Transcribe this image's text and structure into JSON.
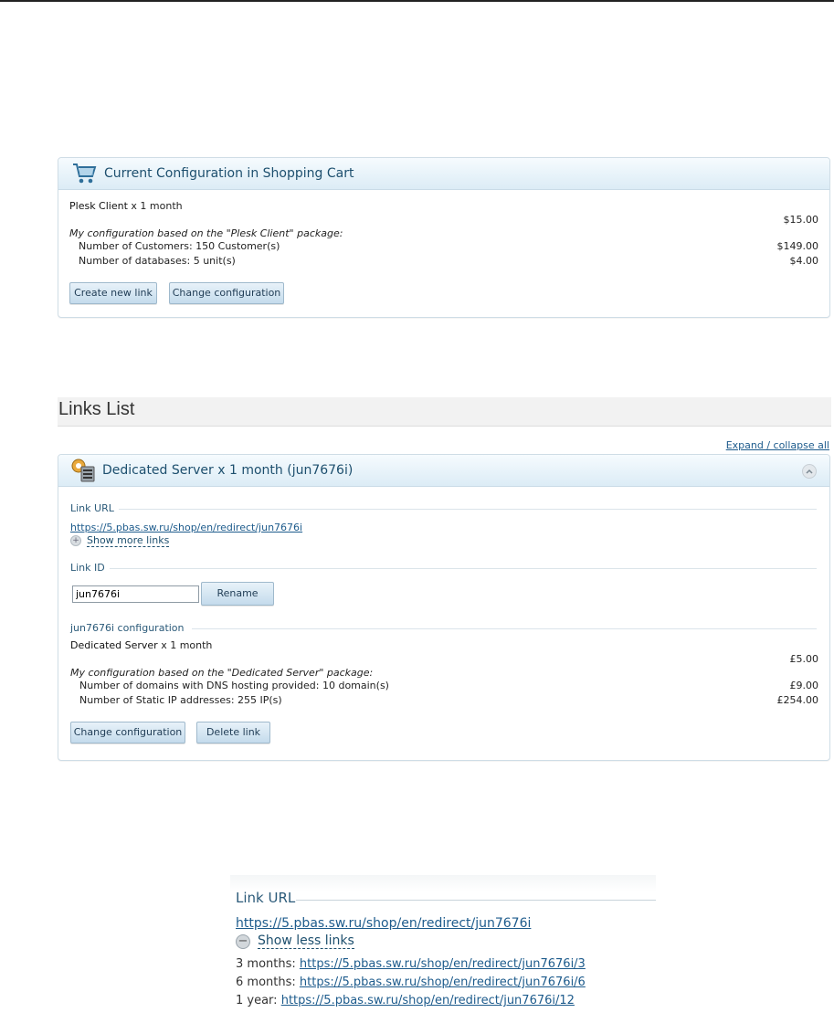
{
  "cart": {
    "title": "Current Configuration in Shopping Cart",
    "product_name": "Plesk Client",
    "product_term": "x 1 month",
    "base_price": "$15.00",
    "config_note": "My configuration based on the \"Plesk Client\" package:",
    "items": [
      {
        "label": "Number of Customers: 150 Customer(s)",
        "price": "$149.00"
      },
      {
        "label": "Number of databases: 5 unit(s)",
        "price": "$4.00"
      }
    ],
    "create_link_label": "Create new link",
    "change_config_label": "Change configuration"
  },
  "links_list": {
    "heading": "Links List",
    "expand_collapse": "Expand / collapse all",
    "item": {
      "title": "Dedicated Server x 1 month (jun7676i)",
      "link_url_label": "Link URL",
      "url": "https://5.pbas.sw.ru/shop/en/redirect/jun7676i",
      "show_more": "Show more links",
      "link_id_label": "Link ID",
      "link_id_value": "jun7676i",
      "rename_label": "Rename",
      "config_label": "jun7676i configuration",
      "product_name": "Dedicated Server",
      "product_term": "x 1 month",
      "base_price": "£5.00",
      "config_note": "My configuration based on the \"Dedicated Server\" package:",
      "items": [
        {
          "label": "Number of domains with DNS hosting provided: 10 domain(s)",
          "price": "£9.00"
        },
        {
          "label": "Number of Static IP addresses: 255 IP(s)",
          "price": "£254.00"
        }
      ],
      "change_config_label": "Change configuration",
      "delete_label": "Delete link"
    }
  },
  "zoom": {
    "link_url_label": "Link URL",
    "url": "https://5.pbas.sw.ru/shop/en/redirect/jun7676i",
    "show_less": "Show less links",
    "periods": [
      {
        "label": "3 months:",
        "url": "https://5.pbas.sw.ru/shop/en/redirect/jun7676i/3"
      },
      {
        "label": "6 months:",
        "url": "https://5.pbas.sw.ru/shop/en/redirect/jun7676i/6"
      },
      {
        "label": "1 year:",
        "url": "https://5.pbas.sw.ru/shop/en/redirect/jun7676i/12"
      }
    ]
  },
  "icons": {
    "cart": "shopping-cart-icon",
    "server": "server-gear-icon",
    "collapse": "chevron-up-icon",
    "expand": "plus-circle-icon",
    "collapse_links": "minus-circle-icon"
  },
  "colors": {
    "header_text": "#1d4f6e",
    "link": "#1d5b8c",
    "button_bg": "#c4dbec"
  }
}
